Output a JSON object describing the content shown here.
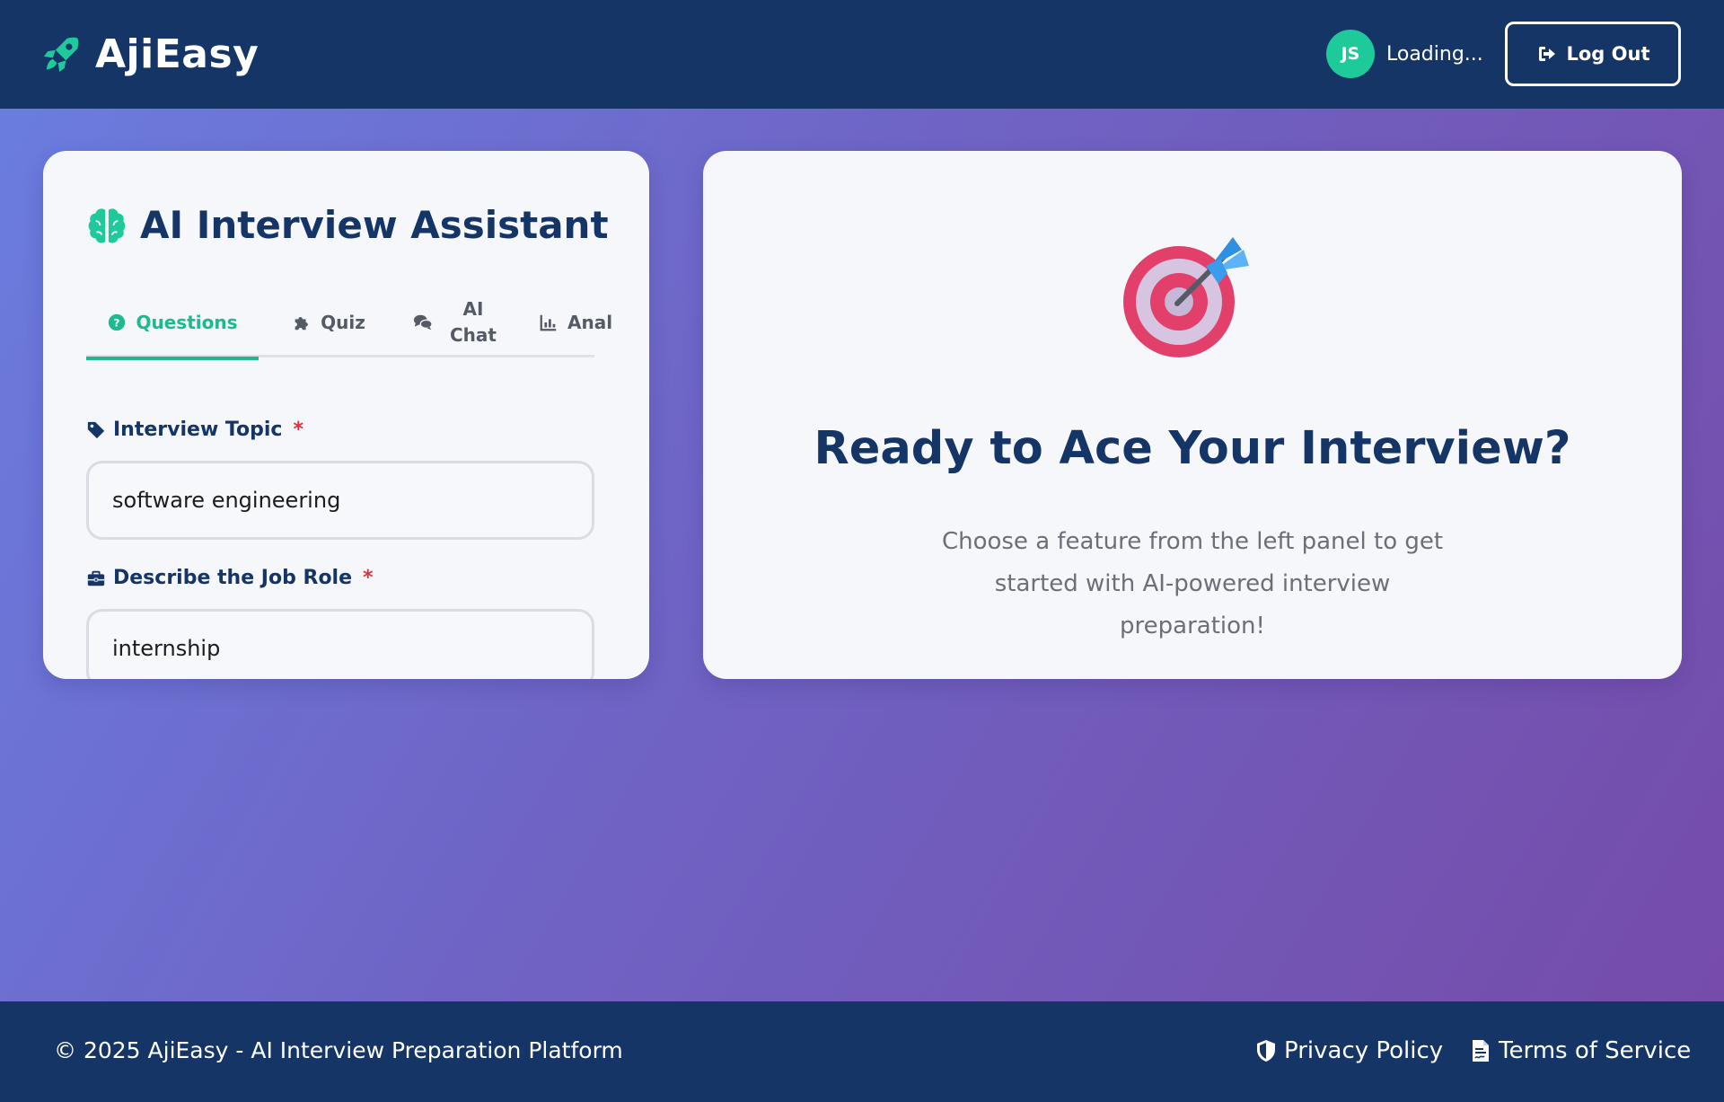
{
  "header": {
    "brand": "AjiEasy",
    "brand_icon": "rocket-icon",
    "avatar_initials": "JS",
    "user_status": "Loading...",
    "logout_label": "Log Out",
    "logout_icon": "sign-out-icon"
  },
  "panel": {
    "title": "AI Interview Assistant",
    "title_icon": "brain-icon",
    "tabs": [
      {
        "label": "Questions",
        "icon": "question-circle-icon",
        "active": true
      },
      {
        "label": "Quiz",
        "icon": "puzzle-icon",
        "active": false
      },
      {
        "label": "AI Chat",
        "icon": "comments-icon",
        "active": false
      },
      {
        "label": "Anal",
        "icon": "chart-icon",
        "active": false
      }
    ],
    "fields": {
      "topic": {
        "label": "Interview Topic",
        "required_mark": "*",
        "value": "software engineering",
        "icon": "tag-icon"
      },
      "role": {
        "label": "Describe the Job Role",
        "required_mark": "*",
        "value": "internship",
        "icon": "briefcase-icon"
      }
    }
  },
  "main": {
    "illustration": "bullseye-dart-icon",
    "title": "Ready to Ace Your Interview?",
    "subtitle": "Choose a feature from the left panel to get started with AI-powered interview preparation!"
  },
  "footer": {
    "copyright": "© 2025 AjiEasy - AI Interview Preparation Platform",
    "links": [
      {
        "label": "Privacy Policy",
        "icon": "shield-icon"
      },
      {
        "label": "Terms of Service",
        "icon": "file-contract-icon"
      }
    ]
  },
  "colors": {
    "navy": "#143566",
    "accent": "#1ec99a",
    "required": "#e0303c",
    "gradient_start": "#6a7ee0",
    "gradient_end": "#764ba8"
  }
}
